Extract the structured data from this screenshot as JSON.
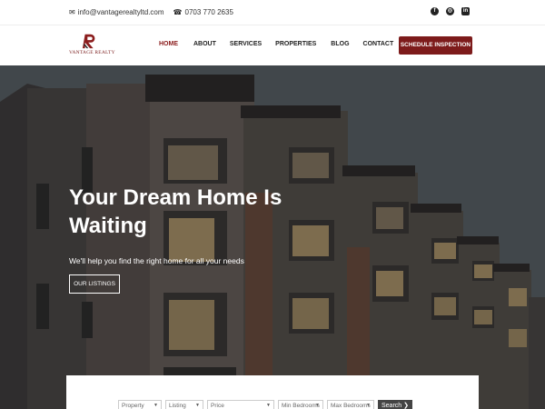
{
  "topbar": {
    "email": "info@vantagerealtyltd.com",
    "phone": "0703 770 2635",
    "social": [
      "facebook-icon",
      "instagram-icon",
      "linkedin-icon"
    ]
  },
  "brand": {
    "name": "VANTAGE REALTY",
    "color": "#7d1b1b"
  },
  "nav": {
    "items": [
      "HOME",
      "ABOUT",
      "SERVICES",
      "PROPERTIES",
      "BLOG",
      "CONTACT"
    ],
    "active": "HOME",
    "cta": "SCHEDULE INSPECTION"
  },
  "hero": {
    "title_line1": "Your Dream Home Is",
    "title_line2": "Waiting",
    "subtitle": "We'll help you find the right home for all your needs",
    "button": "OUR LISTINGS"
  },
  "search": {
    "property_type": "Property Type",
    "listing_type": "Listing Type",
    "price": "Price",
    "min_bedrooms": "Min Bedrooms",
    "max_bedrooms": "Max Bedrooms",
    "button": "Search"
  }
}
